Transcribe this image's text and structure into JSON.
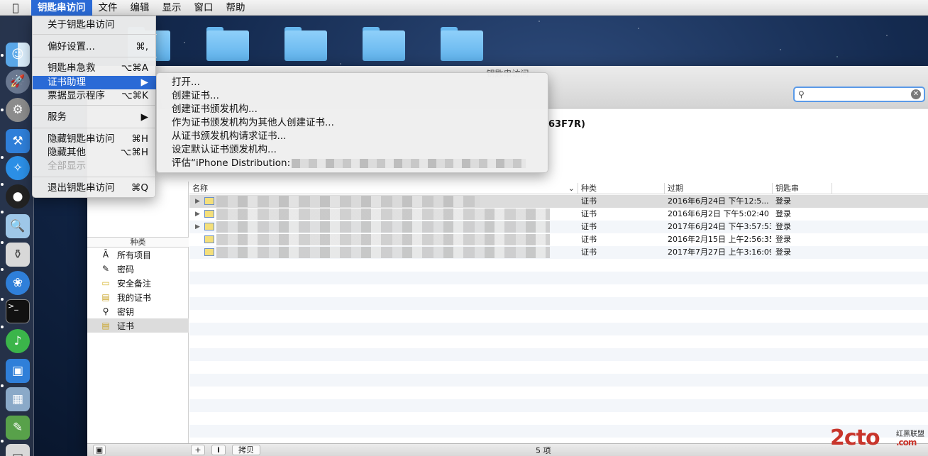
{
  "menubar": {
    "apple": "",
    "items": [
      "钥匙串访问",
      "文件",
      "编辑",
      "显示",
      "窗口",
      "帮助"
    ]
  },
  "app_menu": {
    "items": [
      {
        "label": "关于钥匙串访问",
        "shortcut": ""
      },
      {
        "label": "偏好设置...",
        "shortcut": "⌘,"
      },
      {
        "label": "钥匙串急救",
        "shortcut": "⌥⌘A"
      },
      {
        "label": "证书助理",
        "shortcut": "▶"
      },
      {
        "label": "票据显示程序",
        "shortcut": "⌥⌘K"
      },
      {
        "label": "服务",
        "shortcut": "▶"
      },
      {
        "label": "隐藏钥匙串访问",
        "shortcut": "⌘H"
      },
      {
        "label": "隐藏其他",
        "shortcut": "⌥⌘H"
      },
      {
        "label": "全部显示",
        "shortcut": ""
      },
      {
        "label": "退出钥匙串访问",
        "shortcut": "⌘Q"
      }
    ]
  },
  "cert_submenu": {
    "items": [
      "打开...",
      "创建证书...",
      "创建证书颁发机构...",
      "作为证书颁发机构为其他人创建证书...",
      "从证书颁发机构请求证书...",
      "设定默认证书颁发机构...",
      "评估“iPhone Distribution:"
    ]
  },
  "window": {
    "title": "钥匙串访问",
    "search_value": "",
    "info_title_fragment": "63F7R)"
  },
  "sidebar": {
    "header": "种类",
    "items": [
      {
        "label": "所有项目",
        "icon": "all-items-icon",
        "glyph": "Ā"
      },
      {
        "label": "密码",
        "icon": "password-icon",
        "glyph": "✎"
      },
      {
        "label": "安全备注",
        "icon": "secure-note-icon",
        "glyph": "▭"
      },
      {
        "label": "我的证书",
        "icon": "my-cert-icon",
        "glyph": "▤"
      },
      {
        "label": "密钥",
        "icon": "key-icon",
        "glyph": "⚲"
      },
      {
        "label": "证书",
        "icon": "cert-icon",
        "glyph": "▤"
      }
    ]
  },
  "table": {
    "columns": [
      "名称",
      "种类",
      "过期",
      "钥匙串"
    ],
    "rows": [
      {
        "kind": "证书",
        "expires": "2016年6月24日 下午12:5...",
        "keychain": "登录"
      },
      {
        "kind": "证书",
        "expires": "2016年6月2日 下午5:02:40",
        "keychain": "登录"
      },
      {
        "kind": "证书",
        "expires": "2017年6月24日 下午3:57:53",
        "keychain": "登录"
      },
      {
        "kind": "证书",
        "expires": "2016年2月15日 上午2:56:35",
        "keychain": "登录"
      },
      {
        "kind": "证书",
        "expires": "2017年7月27日 上午3:16:09",
        "keychain": "登录"
      }
    ]
  },
  "bottombar": {
    "add": "+",
    "info": "i",
    "copy": "拷贝",
    "count": "5 项"
  },
  "watermark": {
    "logo": "2cto",
    "sub": "红黑联盟",
    "com": ".com"
  }
}
